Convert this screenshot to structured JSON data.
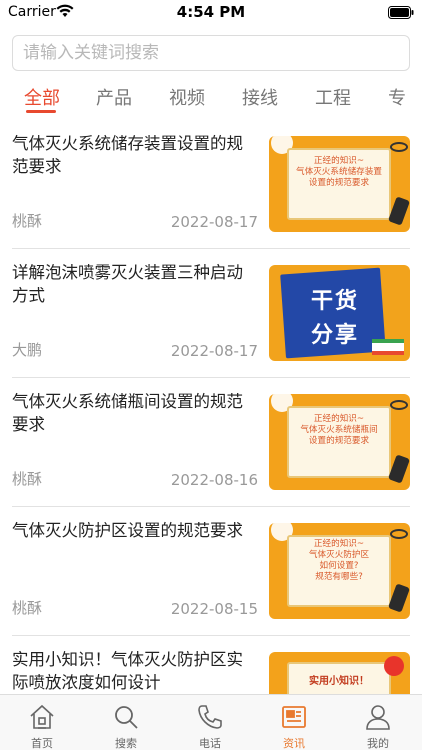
{
  "status_bar": {
    "carrier": "Carrier",
    "time": "4:54 PM",
    "wifi_icon": "wifi-icon",
    "battery_icon": "battery-icon"
  },
  "search": {
    "placeholder": "请输入关键词搜索",
    "value": ""
  },
  "tabs": [
    {
      "label": "全部",
      "active": true
    },
    {
      "label": "产品",
      "active": false
    },
    {
      "label": "视频",
      "active": false
    },
    {
      "label": "接线",
      "active": false
    },
    {
      "label": "工程",
      "active": false
    },
    {
      "label": "专",
      "active": false
    }
  ],
  "articles": [
    {
      "title": "气体灭火系统储存装置设置的规范要求",
      "author": "桃酥",
      "date": "2022-08-17",
      "thumb_lines": [
        "正经的知识~",
        "气体灭火系统储存装置",
        "设置的规范要求"
      ]
    },
    {
      "title": "详解泡沫喷雾灭火装置三种启动方式",
      "author": "大鹏",
      "date": "2022-08-17",
      "thumb_lines": [
        "干货",
        "分享"
      ]
    },
    {
      "title": "气体灭火系统储瓶间设置的规范要求",
      "author": "桃酥",
      "date": "2022-08-16",
      "thumb_lines": [
        "正经的知识~",
        "气体灭火系统储瓶间",
        "设置的规范要求"
      ]
    },
    {
      "title": "气体灭火防护区设置的规范要求",
      "author": "桃酥",
      "date": "2022-08-15",
      "thumb_lines": [
        "正经的知识~",
        "气体灭火防护区",
        "如何设置?",
        "规范有哪些?"
      ]
    },
    {
      "title": "实用小知识！气体灭火防护区实际喷放浓度如何设计",
      "author": "",
      "date": "",
      "thumb_lines": [
        "实用小知识！"
      ]
    }
  ],
  "tabbar": [
    {
      "label": "首页",
      "icon": "home-icon",
      "active": false
    },
    {
      "label": "搜索",
      "icon": "search-icon",
      "active": false
    },
    {
      "label": "电话",
      "icon": "phone-icon",
      "active": false
    },
    {
      "label": "资讯",
      "icon": "news-icon",
      "active": true
    },
    {
      "label": "我的",
      "icon": "user-icon",
      "active": false
    }
  ],
  "colors": {
    "accent": "#e8492f",
    "tab_active": "#e8792f",
    "thumb_orange": "#f3a21b",
    "thumb_blue": "#2348a7"
  }
}
